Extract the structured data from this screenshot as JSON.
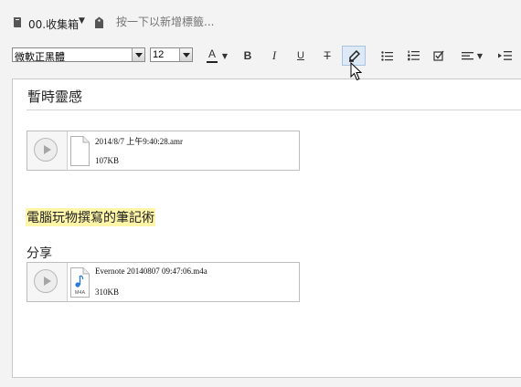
{
  "notebook": {
    "label": "00.收集箱"
  },
  "tags": {
    "placeholder": "按一下以新增標籤..."
  },
  "toolbar": {
    "font_family": "微軟正黑體",
    "font_size": "12",
    "color_label": "A",
    "bold_label": "B",
    "italic_label": "I",
    "underline_label": "U",
    "strike_label": "T",
    "text_color": "#222222",
    "active_tool": "highlight"
  },
  "note": {
    "title": "暫時靈感",
    "attachments": [
      {
        "name": "2014/8/7 上午9:40:28.amr",
        "size": "107KB",
        "file_type": "generic-file-icon"
      },
      {
        "name": "Evernote 20140807 09:47:06.m4a",
        "size": "310KB",
        "file_type": "m4a-file-icon",
        "badge": "M4A"
      }
    ],
    "highlighted_text": "電腦玩物撰寫的筆記術",
    "highlight_color": "#fff5a8",
    "share_text": "分享"
  }
}
